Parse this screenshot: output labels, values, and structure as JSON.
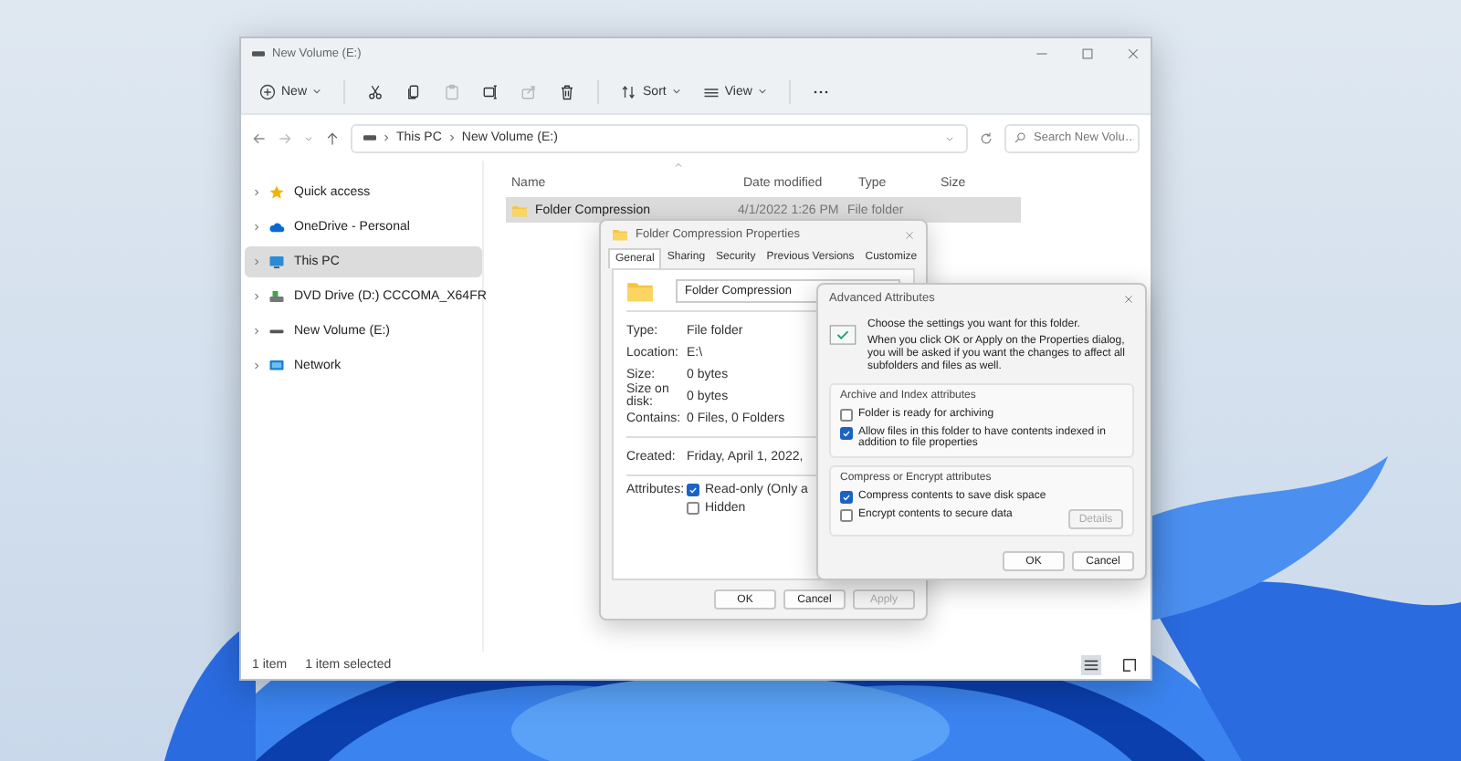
{
  "window": {
    "title": "New Volume (E:)"
  },
  "toolbar": {
    "items": [
      {
        "kind": "new",
        "label": "New",
        "disabled": false
      },
      {
        "kind": "cut",
        "disabled": false
      },
      {
        "kind": "copy",
        "disabled": false
      },
      {
        "kind": "paste",
        "disabled": true
      },
      {
        "kind": "rename",
        "disabled": false
      },
      {
        "kind": "share",
        "disabled": true
      },
      {
        "kind": "delete",
        "disabled": false
      },
      {
        "kind": "sort",
        "label": "Sort",
        "disabled": false
      },
      {
        "kind": "view",
        "label": "View",
        "disabled": false
      },
      {
        "kind": "more",
        "disabled": false
      }
    ]
  },
  "address_bar": {
    "breadcrumb": [
      "This PC",
      "New Volume (E:)"
    ]
  },
  "search": {
    "placeholder": "Search New Volu…"
  },
  "sidebar": {
    "items": [
      {
        "kind": "star",
        "label": "Quick access",
        "selected": false
      },
      {
        "kind": "cloud",
        "label": "OneDrive - Personal",
        "selected": false
      },
      {
        "kind": "pc",
        "label": "This PC",
        "selected": true
      },
      {
        "kind": "dvd",
        "label": "DVD Drive (D:) CCCOMA_X64FR",
        "selected": false
      },
      {
        "kind": "drive",
        "label": "New Volume (E:)",
        "selected": false
      },
      {
        "kind": "network",
        "label": "Network",
        "selected": false
      }
    ]
  },
  "file_list": {
    "columns": [
      "Name",
      "Date modified",
      "Type",
      "Size"
    ],
    "rows": [
      {
        "name": "Folder Compression",
        "date_modified": "4/1/2022 1:26 PM",
        "type": "File folder",
        "selected": true
      }
    ]
  },
  "status_bar": {
    "item_count": "1 item",
    "selection": "1 item selected",
    "views": [
      {
        "kind": "details",
        "selected": true
      },
      {
        "kind": "tiles",
        "selected": false
      }
    ]
  },
  "properties_dialog": {
    "title": "Folder Compression Properties",
    "tabs": [
      {
        "label": "General",
        "selected": true
      },
      {
        "label": "Sharing",
        "selected": false
      },
      {
        "label": "Security",
        "selected": false
      },
      {
        "label": "Previous Versions",
        "selected": false
      },
      {
        "label": "Customize",
        "selected": false
      }
    ],
    "name": "Folder Compression",
    "fields": [
      {
        "label": "Type:",
        "value": "File folder"
      },
      {
        "label": "Location:",
        "value": "E:\\"
      },
      {
        "label": "Size:",
        "value": "0 bytes"
      },
      {
        "label": "Size on disk:",
        "value": "0 bytes"
      },
      {
        "label": "Contains:",
        "value": "0 Files, 0 Folders"
      }
    ],
    "created": {
      "label": "Created:",
      "value": "Friday, April 1, 2022,"
    },
    "attributes": {
      "label": "Attributes:",
      "options": [
        {
          "label": "Read-only (Only a",
          "checked": true
        },
        {
          "label": "Hidden",
          "checked": false
        }
      ]
    },
    "buttons": [
      {
        "label": "OK",
        "disabled": false
      },
      {
        "label": "Cancel",
        "disabled": false
      },
      {
        "label": "Apply",
        "disabled": true
      }
    ]
  },
  "advanced_dialog": {
    "title": "Advanced Attributes",
    "intro": "Choose the settings you want for this folder.",
    "note": "When you click OK or Apply on the Properties dialog, you will be asked if you want the changes to affect all subfolders and files as well.",
    "groups": [
      {
        "title": "Archive and Index attributes",
        "options": [
          {
            "label": "Folder is ready for archiving",
            "checked": false
          },
          {
            "label": "Allow files in this folder to have contents indexed in addition to file properties",
            "checked": true
          }
        ]
      },
      {
        "title": "Compress or Encrypt attributes",
        "options": [
          {
            "label": "Compress contents to save disk space",
            "checked": true
          },
          {
            "label": "Encrypt contents to secure data",
            "checked": false
          }
        ],
        "details_button": {
          "label": "Details",
          "disabled": true
        }
      }
    ],
    "buttons": [
      {
        "label": "OK",
        "disabled": false
      },
      {
        "label": "Cancel",
        "disabled": false
      }
    ]
  }
}
